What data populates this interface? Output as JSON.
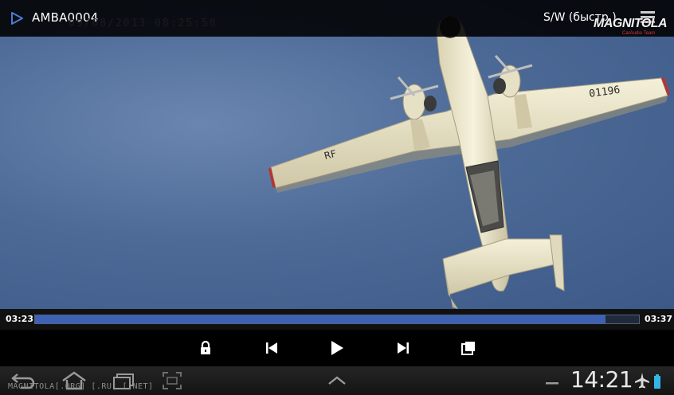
{
  "header": {
    "title": "AMBA0004",
    "osd_timestamp": "09/08/2013 08:25:58",
    "mode_label": "S/W (быстр.)"
  },
  "watermark": {
    "brand": "MAGNITOLA",
    "sub": "CarAudio Team"
  },
  "video": {
    "aircraft_marking_tail": "01196",
    "aircraft_marking_wing": "RF"
  },
  "progress": {
    "current_time": "03:23",
    "total_time": "03:37",
    "fraction": 0.944
  },
  "controls": [
    {
      "name": "lock-button",
      "icon": "lock-icon"
    },
    {
      "name": "previous-button",
      "icon": "skip-previous-icon"
    },
    {
      "name": "play-button",
      "icon": "play-icon"
    },
    {
      "name": "next-button",
      "icon": "skip-next-icon"
    },
    {
      "name": "popup-window-button",
      "icon": "popup-window-icon"
    }
  ],
  "system_bar": {
    "clock": "14:21",
    "bottom_watermark": "MAGNITOLA[.ORG] [.RU] [.NET]",
    "icons": [
      "back-icon",
      "home-icon",
      "recent-apps-icon",
      "screenshot-icon",
      "expand-up-icon",
      "minus-icon",
      "airplane-mode-icon",
      "battery-icon"
    ]
  },
  "colors": {
    "progress_fill": "#3d62b4",
    "sky": "#4d6a97"
  }
}
